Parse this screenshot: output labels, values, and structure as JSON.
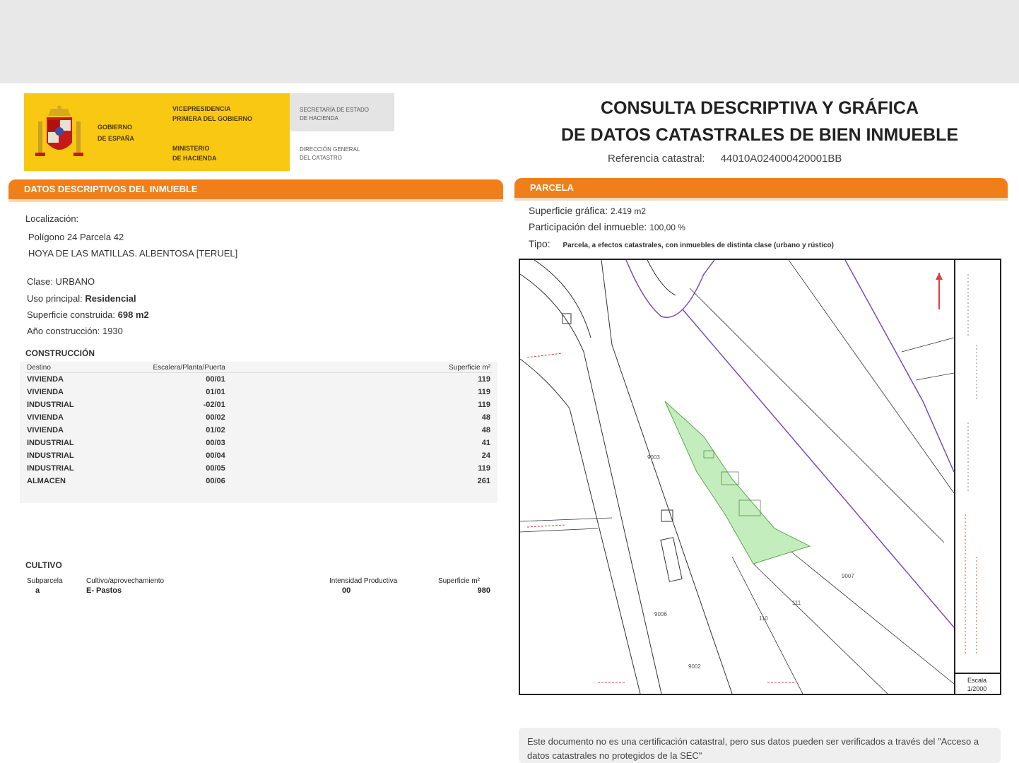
{
  "header": {
    "gov_line1": "GOBIERNO",
    "gov_line2": "DE ESPAÑA",
    "vice_line1": "VICEPRESIDENCIA",
    "vice_line2": "PRIMERA DEL GOBIERNO",
    "min_line1": "MINISTERIO",
    "min_line2": "DE HACIENDA",
    "sec_line1": "SECRETARÍA DE ESTADO",
    "sec_line2": "DE HACIENDA",
    "dir_line1": "DIRECCIÓN GENERAL",
    "dir_line2": "DEL CATASTRO",
    "title_line1": "CONSULTA DESCRIPTIVA Y GRÁFICA",
    "title_line2": "DE DATOS CATASTRALES DE BIEN INMUEBLE",
    "ref_label": "Referencia catastral:",
    "ref_value": "44010A024000420001BB"
  },
  "left": {
    "section_title": "DATOS DESCRIPTIVOS DEL INMUEBLE",
    "localizacion_label": "Localización:",
    "address_line1": "Polígono 24 Parcela 42",
    "address_line2": "HOYA DE LAS MATILLAS. ALBENTOSA [TERUEL]",
    "clase_label": "Clase:",
    "clase_value": "URBANO",
    "uso_label": "Uso principal:",
    "uso_value": "Residencial",
    "sup_label": "Superficie construida:",
    "sup_value": "698 m2",
    "ano_label": "Año construcción:",
    "ano_value": "1930",
    "construccion_title": "CONSTRUCCIÓN",
    "construccion_headers": [
      "Destino",
      "Escalera/Planta/Puerta",
      "Superficie m²"
    ],
    "construccion_rows": [
      [
        "VIVIENDA",
        "00/01",
        "119"
      ],
      [
        "VIVIENDA",
        "01/01",
        "119"
      ],
      [
        "INDUSTRIAL",
        "-02/01",
        "119"
      ],
      [
        "VIVIENDA",
        "00/02",
        "48"
      ],
      [
        "VIVIENDA",
        "01/02",
        "48"
      ],
      [
        "INDUSTRIAL",
        "00/03",
        "41"
      ],
      [
        "INDUSTRIAL",
        "00/04",
        "24"
      ],
      [
        "INDUSTRIAL",
        "00/05",
        "119"
      ],
      [
        "ALMACEN",
        "00/06",
        "261"
      ]
    ],
    "cultivo_title": "CULTIVO",
    "cultivo_headers": [
      "Subparcela",
      "Cultivo/aprovechamiento",
      "Intensidad Productiva",
      "Superficie m²"
    ],
    "cultivo_rows": [
      [
        "a",
        "E- Pastos",
        "00",
        "980"
      ]
    ]
  },
  "right": {
    "section_title": "PARCELA",
    "superficie_label": "Superficie gráfica:",
    "superficie_value": "2.419 m2",
    "participacion_label": "Participación del inmueble:",
    "participacion_value": "100,00 %",
    "tipo_label": "Tipo:",
    "tipo_value": "Parcela, a efectos catastrales, con inmuebles de distinta clase (urbano y rústico)",
    "map_labels": [
      "9003",
      "110",
      "9002",
      "111",
      "9006",
      "9007"
    ],
    "scale_label": "Escala",
    "scale_value": "1/2000"
  },
  "footer": {
    "note": "Este documento no es una certificación catastral, pero sus datos pueden ser verificados a través del \"Acceso a datos catastrales no protegidos de la SEC\""
  }
}
